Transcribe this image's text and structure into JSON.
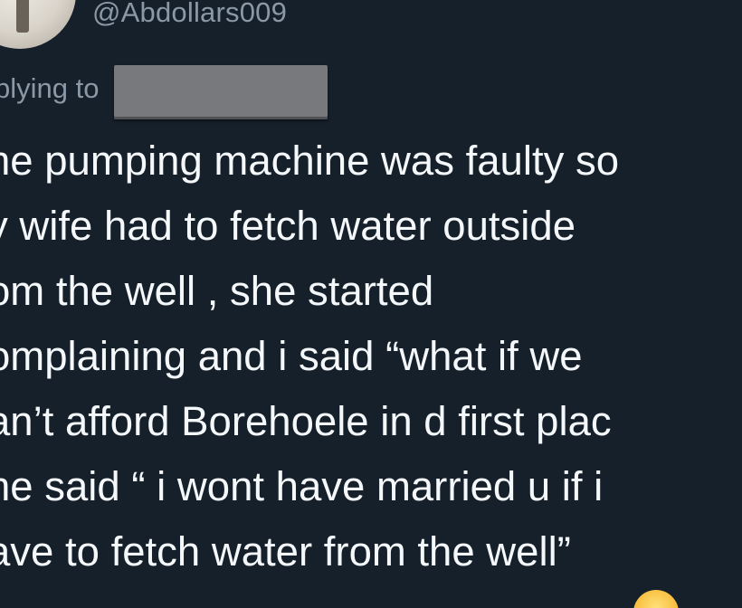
{
  "tweet": {
    "handle": "@Abdollars009",
    "replying_to_label": "plying to",
    "text_lines": [
      "he pumping machine was faulty so",
      "y wife had to fetch water outside",
      "om the well , she started",
      "omplaining and i said “what if we",
      "an’t afford Borehoele in d first plac",
      "he said “ i wont have married u if i",
      "ave to fetch water from the well”"
    ]
  },
  "colors": {
    "background": "#16202b",
    "text": "#f5f8fa",
    "secondary_text": "#8b98a5",
    "redaction_box": "#77797c"
  },
  "icons": {
    "avatar": "profile-photo",
    "emoji": "laughing-face-emoji"
  }
}
